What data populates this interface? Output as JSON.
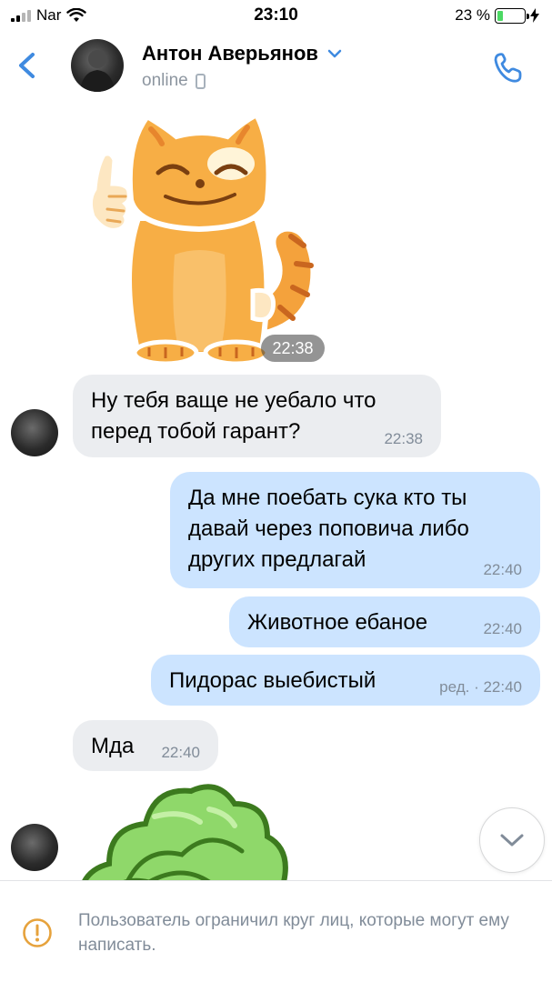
{
  "status_bar": {
    "carrier": "Nar",
    "time": "23:10",
    "battery_percent_label": "23 %",
    "battery_level": 0.23
  },
  "header": {
    "contact_name": "Антон Аверьянов",
    "status": "online"
  },
  "messages": [
    {
      "type": "sticker",
      "direction": "in",
      "sticker": "cat-thumbs-up",
      "time": "22:38"
    },
    {
      "type": "text",
      "direction": "in",
      "text": "Ну тебя ваще не уебало что\nперед тобой гарант?",
      "time": "22:38"
    },
    {
      "type": "text",
      "direction": "out",
      "text": "Да мне поебать сука кто ты\nдавай через поповича либо\nдругих предлагай",
      "time": "22:40"
    },
    {
      "type": "text",
      "direction": "out",
      "text": "Животное ебаное",
      "time": "22:40"
    },
    {
      "type": "text",
      "direction": "out",
      "text": "Пидорас выебистый",
      "time": "ред. · 22:40"
    },
    {
      "type": "text",
      "direction": "in",
      "text": "Мда",
      "time": "22:40"
    },
    {
      "type": "sticker",
      "direction": "in",
      "sticker": "green-bush"
    }
  ],
  "footer": {
    "notice": "Пользователь ограничил круг лиц, которые могут ему написать."
  },
  "colors": {
    "accent": "#3f8ae0",
    "incoming_bubble": "#ebedf0",
    "outgoing_bubble": "#cce4ff",
    "secondary_text": "#818c99"
  }
}
